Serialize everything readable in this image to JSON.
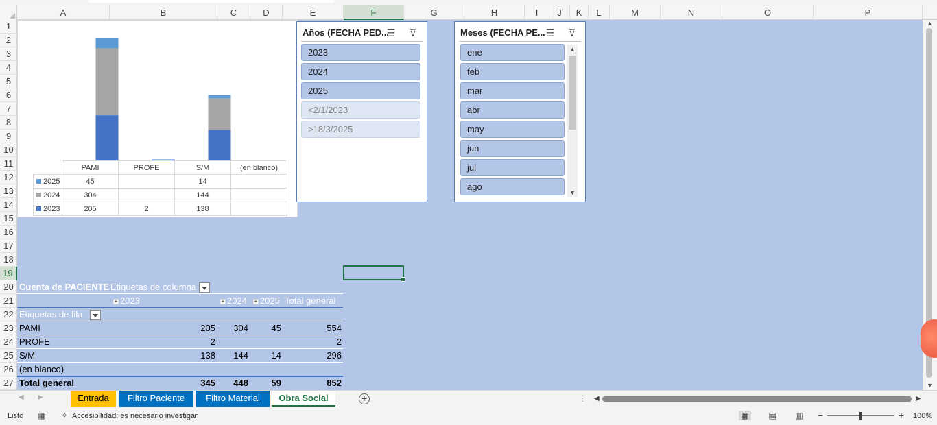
{
  "column_headers": [
    "A",
    "B",
    "C",
    "D",
    "E",
    "F",
    "G",
    "H",
    "I",
    "J",
    "K",
    "L",
    "M",
    "N",
    "O",
    "P"
  ],
  "active_column": "F",
  "row_headers": [
    "1",
    "2",
    "3",
    "4",
    "5",
    "6",
    "7",
    "8",
    "9",
    "10",
    "11",
    "12",
    "13",
    "14",
    "15",
    "16",
    "17",
    "18",
    "19",
    "20",
    "21",
    "22",
    "23",
    "24",
    "25",
    "26",
    "27"
  ],
  "active_row": "19",
  "chart_data": {
    "type": "bar",
    "stacked": true,
    "categories": [
      "PAMI",
      "PROFE",
      "S/M",
      "(en blanco)"
    ],
    "series": [
      {
        "name": "2023",
        "color": "#4472c4",
        "values": [
          205,
          2,
          138,
          null
        ]
      },
      {
        "name": "2024",
        "color": "#a5a5a5",
        "values": [
          304,
          null,
          144,
          null
        ]
      },
      {
        "name": "2025",
        "color": "#5b9bd5",
        "values": [
          45,
          null,
          14,
          null
        ]
      }
    ],
    "data_table": {
      "rows": [
        {
          "label": "2025",
          "color": "#5b9bd5",
          "cells": [
            "45",
            "",
            "14",
            ""
          ]
        },
        {
          "label": "2024",
          "color": "#a5a5a5",
          "cells": [
            "304",
            "",
            "144",
            ""
          ]
        },
        {
          "label": "2023",
          "color": "#4472c4",
          "cells": [
            "205",
            "2",
            "138",
            ""
          ]
        }
      ]
    },
    "ylim": [
      0,
      560
    ]
  },
  "slicer_years": {
    "title": "Años (FECHA PED...",
    "items": [
      {
        "label": "2023",
        "dim": false
      },
      {
        "label": "2024",
        "dim": false
      },
      {
        "label": "2025",
        "dim": false
      },
      {
        "label": "<2/1/2023",
        "dim": true
      },
      {
        "label": ">18/3/2025",
        "dim": true
      }
    ]
  },
  "slicer_months": {
    "title": "Meses (FECHA PE...",
    "items": [
      "ene",
      "feb",
      "mar",
      "abr",
      "may",
      "jun",
      "jul",
      "ago"
    ]
  },
  "pivot": {
    "value_field": "Cuenta de PACIENTE",
    "column_labels": "Etiquetas de columna",
    "row_labels": "Etiquetas de fila",
    "years": [
      "2023",
      "2024",
      "2025"
    ],
    "grand_total_label": "Total general",
    "rows": [
      {
        "label": "PAMI",
        "v2023": "205",
        "v2024": "304",
        "v2025": "45",
        "total": "554"
      },
      {
        "label": "PROFE",
        "v2023": "2",
        "v2024": "",
        "v2025": "",
        "total": "2"
      },
      {
        "label": "S/M",
        "v2023": "138",
        "v2024": "144",
        "v2025": "14",
        "total": "296"
      },
      {
        "label": "(en blanco)",
        "v2023": "",
        "v2024": "",
        "v2025": "",
        "total": ""
      }
    ],
    "totals": {
      "label": "Total general",
      "v2023": "345",
      "v2024": "448",
      "v2025": "59",
      "total": "852"
    }
  },
  "sheet_tabs": [
    {
      "label": "Entrada",
      "color": "#ffc000",
      "text": "#000000"
    },
    {
      "label": "Filtro Paciente",
      "color": "#0070c0",
      "text": "#ffffff"
    },
    {
      "label": "Filtro Material",
      "color": "#0070c0",
      "text": "#ffffff"
    },
    {
      "label": "Obra Social",
      "active": true
    }
  ],
  "status": {
    "ready": "Listo",
    "accessibility": "Accesibilidad: es necesario investigar",
    "zoom": "100%"
  }
}
